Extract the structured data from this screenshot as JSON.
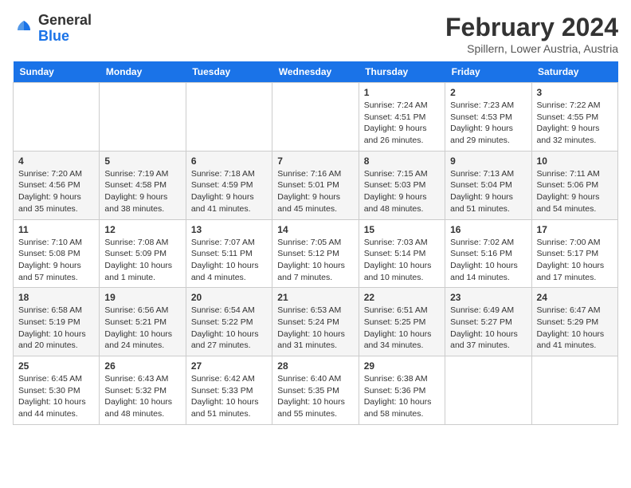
{
  "header": {
    "logo_general": "General",
    "logo_blue": "Blue",
    "month_title": "February 2024",
    "location": "Spillern, Lower Austria, Austria"
  },
  "weekdays": [
    "Sunday",
    "Monday",
    "Tuesday",
    "Wednesday",
    "Thursday",
    "Friday",
    "Saturday"
  ],
  "weeks": [
    [
      {
        "day": "",
        "info": ""
      },
      {
        "day": "",
        "info": ""
      },
      {
        "day": "",
        "info": ""
      },
      {
        "day": "",
        "info": ""
      },
      {
        "day": "1",
        "info": "Sunrise: 7:24 AM\nSunset: 4:51 PM\nDaylight: 9 hours\nand 26 minutes."
      },
      {
        "day": "2",
        "info": "Sunrise: 7:23 AM\nSunset: 4:53 PM\nDaylight: 9 hours\nand 29 minutes."
      },
      {
        "day": "3",
        "info": "Sunrise: 7:22 AM\nSunset: 4:55 PM\nDaylight: 9 hours\nand 32 minutes."
      }
    ],
    [
      {
        "day": "4",
        "info": "Sunrise: 7:20 AM\nSunset: 4:56 PM\nDaylight: 9 hours\nand 35 minutes."
      },
      {
        "day": "5",
        "info": "Sunrise: 7:19 AM\nSunset: 4:58 PM\nDaylight: 9 hours\nand 38 minutes."
      },
      {
        "day": "6",
        "info": "Sunrise: 7:18 AM\nSunset: 4:59 PM\nDaylight: 9 hours\nand 41 minutes."
      },
      {
        "day": "7",
        "info": "Sunrise: 7:16 AM\nSunset: 5:01 PM\nDaylight: 9 hours\nand 45 minutes."
      },
      {
        "day": "8",
        "info": "Sunrise: 7:15 AM\nSunset: 5:03 PM\nDaylight: 9 hours\nand 48 minutes."
      },
      {
        "day": "9",
        "info": "Sunrise: 7:13 AM\nSunset: 5:04 PM\nDaylight: 9 hours\nand 51 minutes."
      },
      {
        "day": "10",
        "info": "Sunrise: 7:11 AM\nSunset: 5:06 PM\nDaylight: 9 hours\nand 54 minutes."
      }
    ],
    [
      {
        "day": "11",
        "info": "Sunrise: 7:10 AM\nSunset: 5:08 PM\nDaylight: 9 hours\nand 57 minutes."
      },
      {
        "day": "12",
        "info": "Sunrise: 7:08 AM\nSunset: 5:09 PM\nDaylight: 10 hours\nand 1 minute."
      },
      {
        "day": "13",
        "info": "Sunrise: 7:07 AM\nSunset: 5:11 PM\nDaylight: 10 hours\nand 4 minutes."
      },
      {
        "day": "14",
        "info": "Sunrise: 7:05 AM\nSunset: 5:12 PM\nDaylight: 10 hours\nand 7 minutes."
      },
      {
        "day": "15",
        "info": "Sunrise: 7:03 AM\nSunset: 5:14 PM\nDaylight: 10 hours\nand 10 minutes."
      },
      {
        "day": "16",
        "info": "Sunrise: 7:02 AM\nSunset: 5:16 PM\nDaylight: 10 hours\nand 14 minutes."
      },
      {
        "day": "17",
        "info": "Sunrise: 7:00 AM\nSunset: 5:17 PM\nDaylight: 10 hours\nand 17 minutes."
      }
    ],
    [
      {
        "day": "18",
        "info": "Sunrise: 6:58 AM\nSunset: 5:19 PM\nDaylight: 10 hours\nand 20 minutes."
      },
      {
        "day": "19",
        "info": "Sunrise: 6:56 AM\nSunset: 5:21 PM\nDaylight: 10 hours\nand 24 minutes."
      },
      {
        "day": "20",
        "info": "Sunrise: 6:54 AM\nSunset: 5:22 PM\nDaylight: 10 hours\nand 27 minutes."
      },
      {
        "day": "21",
        "info": "Sunrise: 6:53 AM\nSunset: 5:24 PM\nDaylight: 10 hours\nand 31 minutes."
      },
      {
        "day": "22",
        "info": "Sunrise: 6:51 AM\nSunset: 5:25 PM\nDaylight: 10 hours\nand 34 minutes."
      },
      {
        "day": "23",
        "info": "Sunrise: 6:49 AM\nSunset: 5:27 PM\nDaylight: 10 hours\nand 37 minutes."
      },
      {
        "day": "24",
        "info": "Sunrise: 6:47 AM\nSunset: 5:29 PM\nDaylight: 10 hours\nand 41 minutes."
      }
    ],
    [
      {
        "day": "25",
        "info": "Sunrise: 6:45 AM\nSunset: 5:30 PM\nDaylight: 10 hours\nand 44 minutes."
      },
      {
        "day": "26",
        "info": "Sunrise: 6:43 AM\nSunset: 5:32 PM\nDaylight: 10 hours\nand 48 minutes."
      },
      {
        "day": "27",
        "info": "Sunrise: 6:42 AM\nSunset: 5:33 PM\nDaylight: 10 hours\nand 51 minutes."
      },
      {
        "day": "28",
        "info": "Sunrise: 6:40 AM\nSunset: 5:35 PM\nDaylight: 10 hours\nand 55 minutes."
      },
      {
        "day": "29",
        "info": "Sunrise: 6:38 AM\nSunset: 5:36 PM\nDaylight: 10 hours\nand 58 minutes."
      },
      {
        "day": "",
        "info": ""
      },
      {
        "day": "",
        "info": ""
      }
    ]
  ]
}
